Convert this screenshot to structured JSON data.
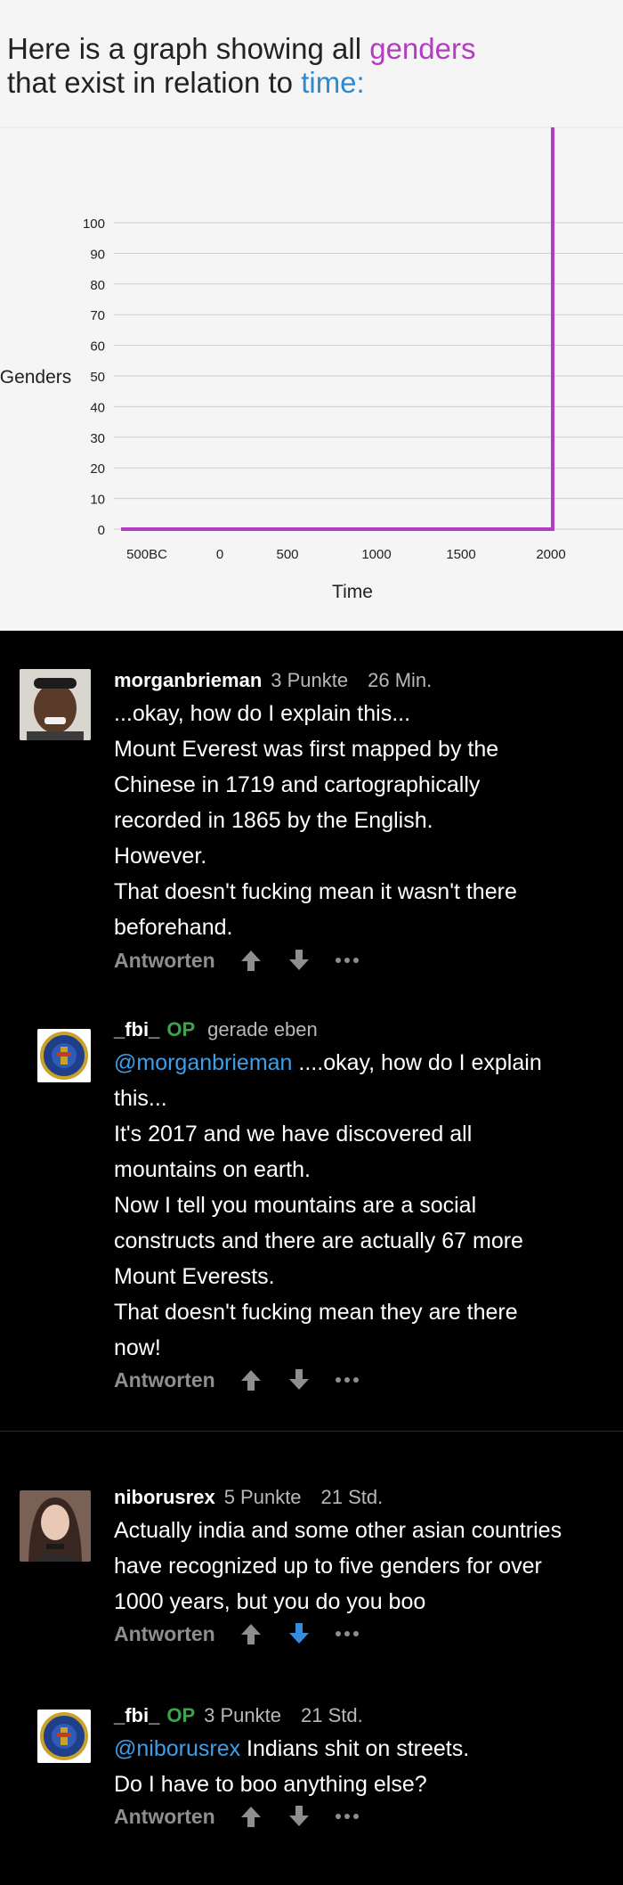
{
  "meme": {
    "title_line1_pre": "Here is a graph showing all ",
    "title_word1": "genders",
    "title_line2_pre": "that exist in relation to ",
    "title_word2": "time:"
  },
  "chart_data": {
    "type": "line",
    "xlabel": "Time",
    "ylabel": "Genders",
    "x_tick_labels": [
      "500BC",
      "0",
      "500",
      "1000",
      "1500",
      "2000"
    ],
    "y_ticks": [
      0,
      10,
      20,
      30,
      40,
      50,
      60,
      70,
      80,
      90,
      100
    ],
    "ylim": [
      0,
      100
    ],
    "series": [
      {
        "x": [
          "500BC",
          "0",
          "500",
          "1000",
          "1500",
          2010,
          2010
        ],
        "y": [
          0,
          0,
          0,
          0,
          0,
          0,
          100
        ]
      }
    ],
    "line_color": "#b43cc2",
    "grid": true
  },
  "comments": [
    {
      "user": "morganbrieman",
      "op": "",
      "points": "3 Punkte",
      "time": "26 Min.",
      "lines": [
        "...okay, how do I explain this...",
        "Mount Everest was first mapped by the",
        "Chinese in 1719 and cartographically",
        "recorded in 1865 by the English.",
        "However.",
        "That doesn't fucking mean it wasn't there",
        "beforehand."
      ],
      "reply": "Antworten",
      "avatar": "meme-face-avatar",
      "down_active": false
    },
    {
      "user": "_fbi_",
      "op": "OP",
      "points": "",
      "time": "gerade eben",
      "mention": "@morganbrieman",
      "first_rest": " ....okay, how do I explain",
      "lines": [
        "this...",
        "It's 2017 and we have discovered all",
        "mountains on earth.",
        "Now I tell you mountains are a social",
        "constructs and there are actually 67 more",
        "Mount Everests.",
        "That doesn't fucking mean they are there",
        "now!"
      ],
      "reply": "Antworten",
      "avatar": "fbi-seal-avatar",
      "down_active": false
    },
    {
      "user": "niborusrex",
      "op": "",
      "points": "5 Punkte",
      "time": "21 Std.",
      "lines": [
        "Actually india and some other asian countries",
        "have recognized up to five genders for over",
        "1000 years, but you do you boo"
      ],
      "reply": "Antworten",
      "avatar": "woman-avatar",
      "down_active": true
    },
    {
      "user": "_fbi_",
      "op": "OP",
      "points": "3 Punkte",
      "time": "21 Std.",
      "mention": "@niborusrex",
      "first_rest": " Indians shit on streets.",
      "lines": [
        "Do I have to boo anything else?"
      ],
      "reply": "Antworten",
      "avatar": "fbi-seal-avatar",
      "down_active": false
    }
  ],
  "colors": {
    "upvote": "#8e8e8e",
    "downvote_active": "#2f8de4",
    "op_badge": "#3ea34a",
    "mention": "#3e9ee8"
  }
}
